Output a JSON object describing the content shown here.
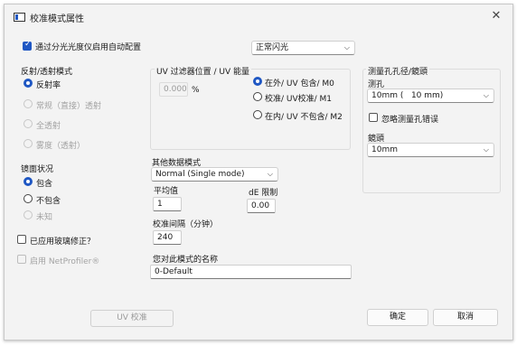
{
  "window": {
    "title": "校准模式属性",
    "close_glyph": "✕"
  },
  "auto_config": {
    "label": "通过分光光度仪启用自动配置",
    "checked": true
  },
  "illuminant": {
    "value": "正常闪光"
  },
  "reflect_mode": {
    "label": "反射/透射模式",
    "options": [
      "反射率",
      "常规（直接）透射",
      "全透射",
      "雾度（透射）"
    ],
    "selected": 0
  },
  "uv": {
    "label": "UV 过滤器位置 / UV 能量",
    "value": "0.000",
    "unit": "%",
    "options": [
      "在外/ UV 包含/ M0",
      "校准/ UV校准/ M1",
      "在内/ UV 不包含/ M2"
    ],
    "selected": 0
  },
  "aperture": {
    "label": "测量孔孔径/鏡頭",
    "aperture_label": "测孔",
    "aperture_value": "10mm (   10 mm)",
    "ignore_label": "忽略测量孔错误",
    "lens_label": "鏡頭",
    "lens_value": "10mm"
  },
  "specular": {
    "label": "镜面状况",
    "options": [
      "包含",
      "不包含",
      "未知"
    ],
    "selected": 0
  },
  "other_data": {
    "label": "其他数据模式",
    "value": "Normal (Single mode)"
  },
  "average": {
    "label": "平均值",
    "value": "1"
  },
  "de_limit": {
    "label": "dE 限制",
    "value": "0.00"
  },
  "interval": {
    "label": "校准间隔（分钟）",
    "value": "240"
  },
  "glass_correction": {
    "label": "已应用玻璃修正？"
  },
  "netprofiler": {
    "label": "启用 NetProfiler®"
  },
  "mode_name": {
    "label": "您对此模式的名称",
    "value": "0-Default"
  },
  "buttons": {
    "uv_calibrate": "UV 校准",
    "ok": "确定",
    "cancel": "取消"
  }
}
